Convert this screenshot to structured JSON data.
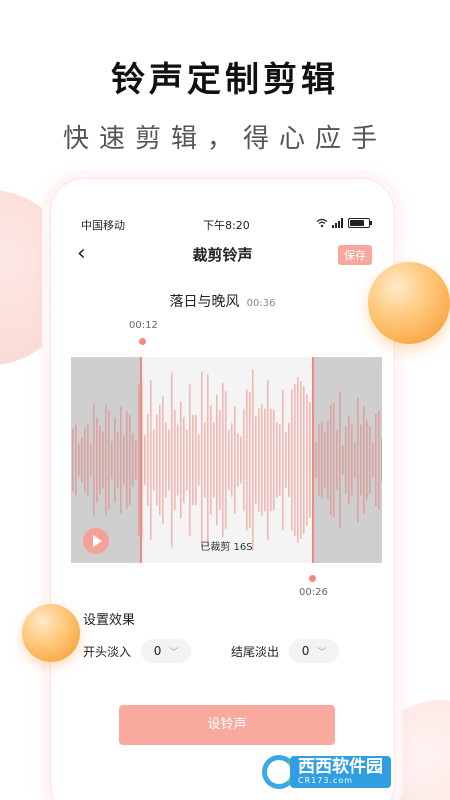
{
  "promo": {
    "headline": "铃声定制剪辑",
    "subline": "快速剪辑，得心应手"
  },
  "statusbar": {
    "carrier": "中国移动",
    "time": "下午8:20",
    "battery_level": 0.75
  },
  "navbar": {
    "title": "裁剪铃声",
    "save_label": "保存"
  },
  "song": {
    "title": "落日与晚风",
    "duration": "00:36"
  },
  "trim": {
    "start_time": "00:12",
    "end_time": "00:26",
    "clipped_label": "已裁剪 16S"
  },
  "settings": {
    "title": "设置效果",
    "fade_in_label": "开头淡入",
    "fade_in_value": "0",
    "fade_out_label": "结尾淡出",
    "fade_out_value": "0"
  },
  "action": {
    "set_ringtone_label": "设铃声"
  },
  "watermark": {
    "brand": "西西",
    "site": "软件园",
    "domain": "CR173.com"
  },
  "colors": {
    "accent": "#f4887d",
    "button": "#f9aa9f",
    "wave": "#f2b7b0",
    "wave_dim": "#d9a3a0",
    "orb": "#f8a847"
  }
}
